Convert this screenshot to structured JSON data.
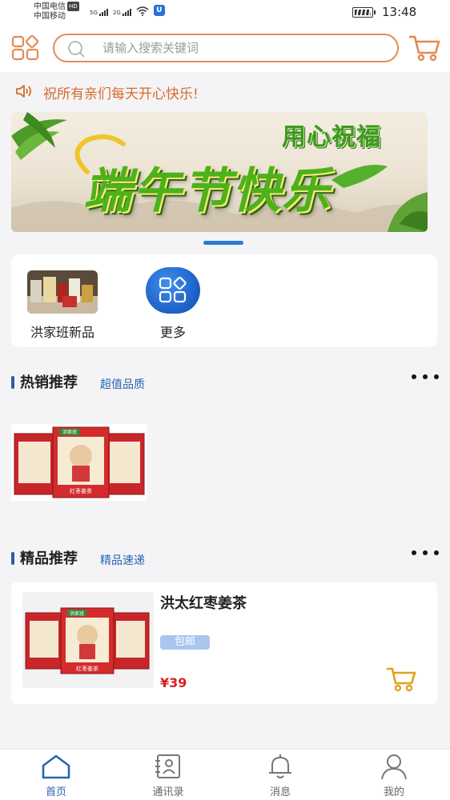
{
  "status_bar": {
    "carrier_1": "中国电信",
    "carrier_1_badge": "HD",
    "carrier_2": "中国移动",
    "network_1": "5G",
    "network_2": "2G",
    "time": "13:48"
  },
  "header": {
    "apps_icon": "apps-grid-icon",
    "search_placeholder": "请输入搜索关键词",
    "search_value": "",
    "cart_icon": "cart-icon",
    "accent_color": "#e58a53"
  },
  "notice": {
    "icon": "speaker-icon",
    "text": "祝所有亲们每天开心快乐!"
  },
  "banner": {
    "subtitle": "用心祝福",
    "title": "端午节快乐"
  },
  "quick_entries": [
    {
      "label": "洪家班新品",
      "icon": "product-thumbnail"
    },
    {
      "label": "更多",
      "icon": "more-apps-icon"
    }
  ],
  "hot_section": {
    "title": "热销推荐",
    "subtitle": "超值品质"
  },
  "premium_section": {
    "title": "精品推荐",
    "subtitle": "精品速递"
  },
  "product": {
    "name": "洪太红枣姜茶",
    "tag": "包邮",
    "price": "¥39",
    "box_label": "红枣姜茶",
    "box_brand": "洪家班"
  },
  "bottom_nav": [
    {
      "label": "首页",
      "icon": "home-icon",
      "active": true
    },
    {
      "label": "通讯录",
      "icon": "contacts-icon",
      "active": false
    },
    {
      "label": "消息",
      "icon": "bell-icon",
      "active": false
    },
    {
      "label": "我的",
      "icon": "user-icon",
      "active": false
    }
  ],
  "colors": {
    "primary_blue": "#2b7bd6",
    "price_red": "#d41f1f",
    "notice_orange": "#d86a2c",
    "cart_gold": "#e0a21a"
  }
}
